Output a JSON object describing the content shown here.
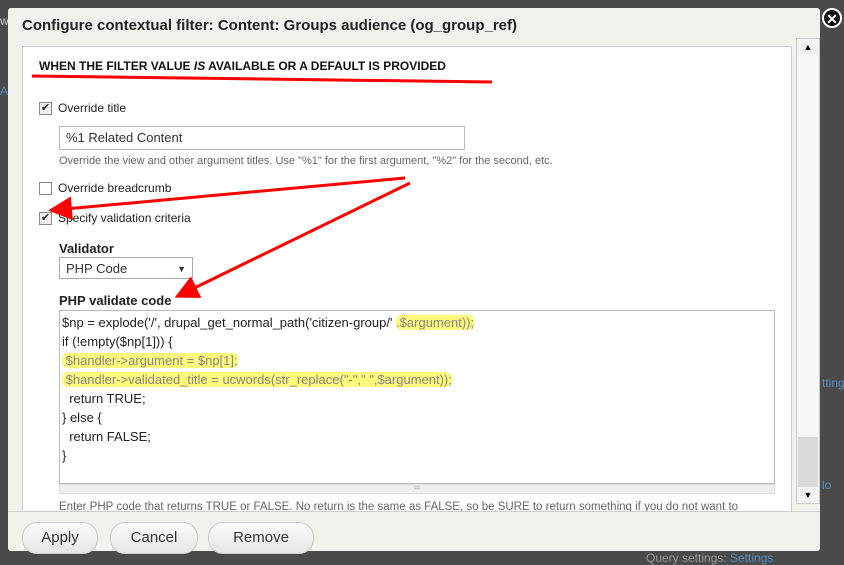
{
  "background": {
    "left_fragment_1": "w",
    "left_fragment_2": "A",
    "right_fragment_1": "ttings",
    "right_fragment_2": "lo",
    "bottom_text": "Query settings:",
    "bottom_link": "Settings"
  },
  "dialog": {
    "title": "Configure contextual filter: Content: Groups audience (og_group_ref)",
    "close_icon": "close-icon"
  },
  "form": {
    "section_title_pre": "WHEN THE FILTER VALUE ",
    "section_title_em": "IS",
    "section_title_post": " AVAILABLE OR A DEFAULT IS PROVIDED",
    "override_title": {
      "label": "Override title",
      "checked": true
    },
    "title_input": {
      "value": "%1 Related Content"
    },
    "title_desc": "Override the view and other argument titles. Use \"%1\" for the first argument, \"%2\" for the second, etc.",
    "override_breadcrumb": {
      "label": "Override breadcrumb",
      "checked": false
    },
    "specify_validation": {
      "label": "Specify validation criteria",
      "checked": true
    },
    "validator_label": "Validator",
    "validator_value": "PHP Code",
    "php_label": "PHP validate code",
    "code_lines": [
      "$np = explode('/', drupal_get_normal_path('citizen-group/' ",
      ".$argument));",
      "if (!empty($np[1])) {",
      " $handler->argument = $np[1];",
      " $handler->validated_title = ucwords(str_replace(\"-\",\" \",$argument));",
      "  return TRUE;",
      "} else {",
      "  return FALSE;",
      "}"
    ],
    "php_desc": "Enter PHP code that returns TRUE or FALSE. No return is the same as FALSE, so be SURE to return something if you do not want to"
  },
  "buttons": {
    "apply": "Apply",
    "cancel": "Cancel",
    "remove": "Remove"
  },
  "colors": {
    "annotation": "#ff0000",
    "highlight": "#fdf97a"
  }
}
